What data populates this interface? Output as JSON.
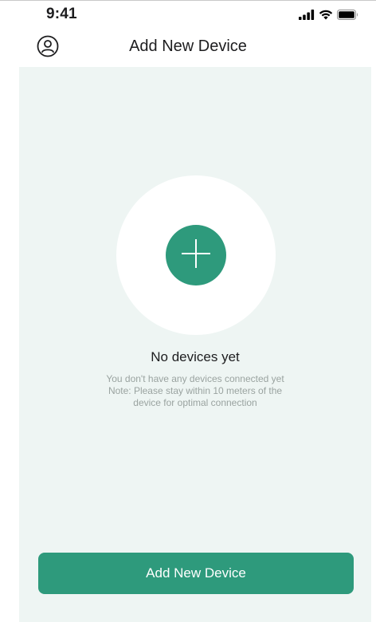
{
  "status_bar": {
    "time": "9:41",
    "icons": [
      "signal-icon",
      "wifi-icon",
      "battery-icon"
    ]
  },
  "nav": {
    "title": "Add New Device",
    "left_icon": "profile-icon"
  },
  "empty_state": {
    "icon": "plus-icon",
    "title": "No devices yet",
    "description_lines": [
      "You don't have any devices connected yet",
      "Note: Please stay within 10 meters of the",
      "device for optimal connection"
    ]
  },
  "primary_button": {
    "label": "Add New Device"
  },
  "colors": {
    "accent": "#2e9a7c",
    "background": "#eef5f3",
    "text_primary": "#1d1d1f",
    "text_secondary": "#9aa3a0"
  }
}
